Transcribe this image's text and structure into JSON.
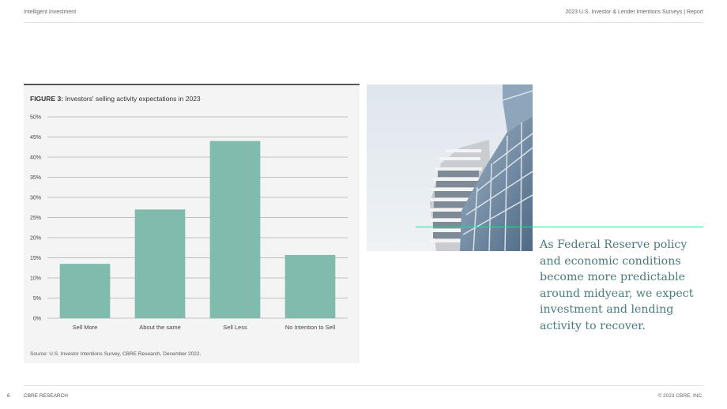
{
  "header": {
    "left": "Intelligent Investment",
    "right": "2023 U.S. Investor & Lender Intentions Surveys   |   Report"
  },
  "figure": {
    "label": "FIGURE 3:",
    "title": "Investors' selling activity expectations in 2023",
    "source": "Source: U.S. Investor Intentions Survey, CBRE Research, December 2022."
  },
  "chart_data": {
    "type": "bar",
    "title": "Investors' selling activity expectations in 2023",
    "categories": [
      "Sell More",
      "About the same",
      "Sell Less",
      "No Intention to Sell"
    ],
    "values": [
      13.5,
      27,
      44,
      15.7
    ],
    "ylim": [
      0,
      50
    ],
    "yticks": [
      "0%",
      "5%",
      "10%",
      "15%",
      "20%",
      "25%",
      "30%",
      "35%",
      "40%",
      "45%",
      "50%"
    ],
    "bar_color": "#80bbad",
    "grid": true
  },
  "quote": "As Federal Reserve policy and economic conditions become more predictable around midyear, we expect investment and lending activity to recover.",
  "footer": {
    "page": "6",
    "left": "CBRE RESEARCH",
    "right": "© 2023 CBRE, INC."
  },
  "colors": {
    "accent": "#17e88f",
    "quote_text": "#4b7a80"
  }
}
